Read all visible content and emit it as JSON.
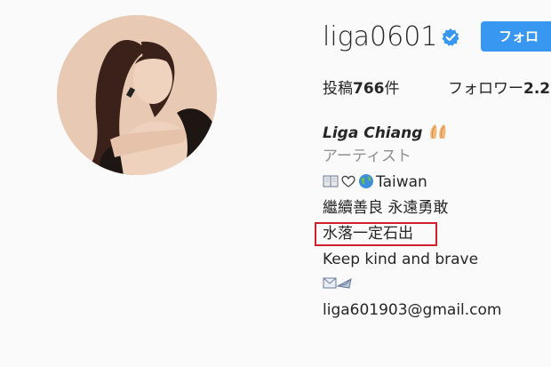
{
  "profile": {
    "username": "liga0601",
    "follow_label": "フォロ",
    "stats": {
      "posts_prefix": "投稿",
      "posts_count": "766",
      "posts_suffix": "件",
      "followers_prefix": "フォロワー",
      "followers_count": "2.2"
    },
    "bio": {
      "name": "Liga Chiang",
      "category": "アーティスト",
      "location": "Taiwan",
      "line_chinese_1": "繼續善良 永遠勇敢",
      "line_chinese_2": "水落一定石出",
      "line_english": "Keep kind and brave",
      "email": "liga601903@gmail.com"
    }
  },
  "icons": {
    "verified": "verified-badge-icon",
    "name_emoji": "hands-emoji-icon",
    "book": "book-emoji-icon",
    "heart": "heart-emoji-icon",
    "globe": "globe-emoji-icon",
    "mail": "mail-emoji-icon"
  },
  "colors": {
    "accent": "#3897f0",
    "highlight": "#d0202a",
    "category": "#8e8e8e"
  }
}
